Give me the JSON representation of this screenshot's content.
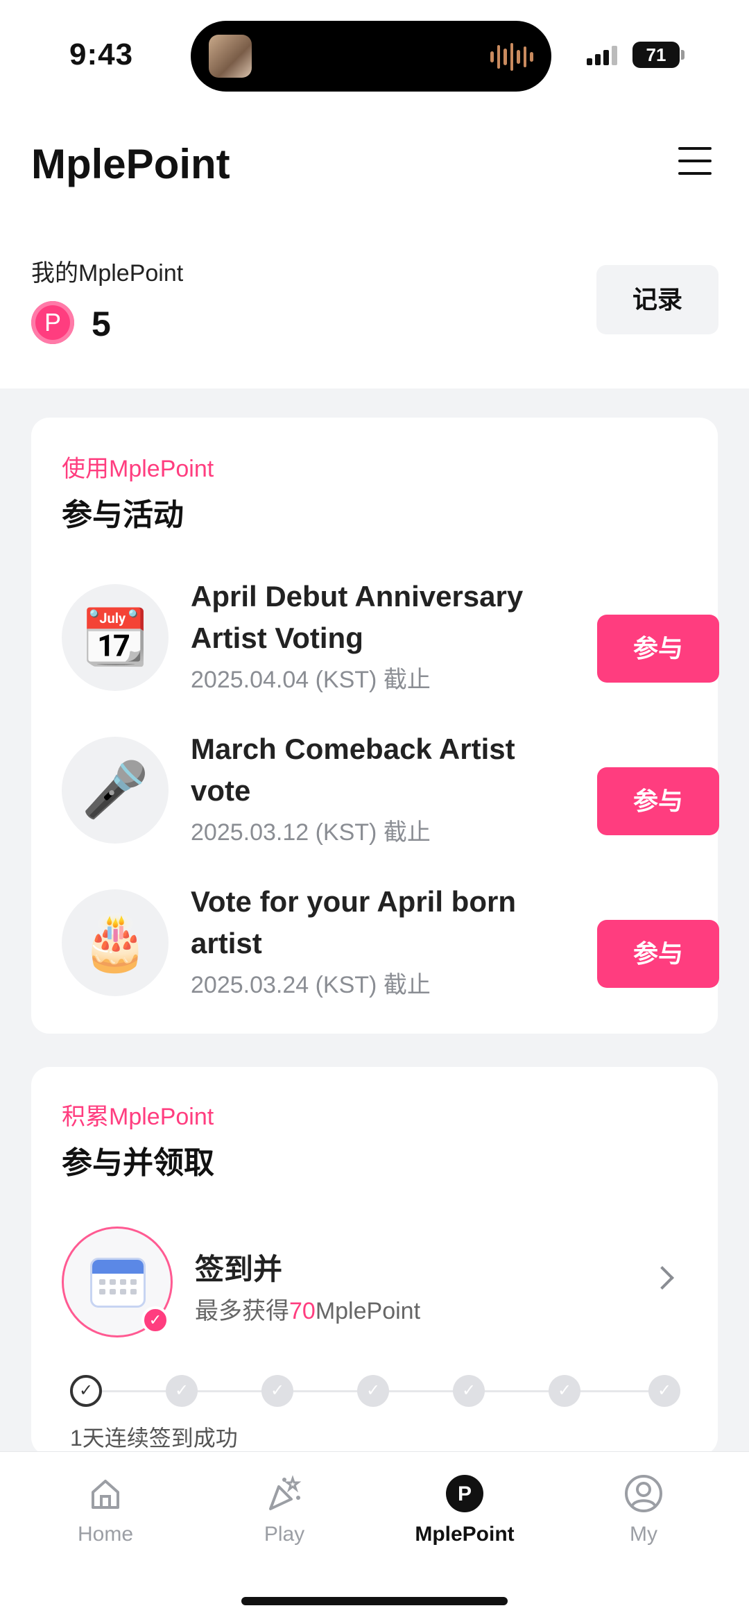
{
  "status_bar": {
    "time": "9:43",
    "battery": "71"
  },
  "header": {
    "title": "MplePoint",
    "menu_icon": "hamburger-menu-icon"
  },
  "points": {
    "label": "我的MplePoint",
    "badge": "P",
    "value": "5",
    "record_button": "记录"
  },
  "events_card": {
    "kicker": "使用MplePoint",
    "title": "参与活动",
    "events": [
      {
        "name": "April Debut Anniversary Artist Voting",
        "deadline": "2025.04.04 (KST) 截止",
        "icon": "calendar-heart-icon",
        "button": "参与"
      },
      {
        "name": "March Comeback Artist vote",
        "deadline": "2025.03.12 (KST) 截止",
        "icon": "microphone-icon",
        "button": "参与"
      },
      {
        "name": "Vote for your April born artist",
        "deadline": "2025.03.24 (KST) 截止",
        "icon": "birthday-cake-icon",
        "button": "参与"
      }
    ]
  },
  "earn_card": {
    "kicker": "积累MplePoint",
    "title": "参与并领取",
    "checkin_title": "签到并",
    "checkin_sub_prefix": "最多获得",
    "checkin_sub_amount": "70",
    "checkin_sub_suffix": "MplePoint",
    "streak_text": "1天连续签到成功"
  },
  "bottom_nav": [
    {
      "label": "Home",
      "icon": "home-icon",
      "active": false
    },
    {
      "label": "Play",
      "icon": "party-popper-icon",
      "active": false
    },
    {
      "label": "MplePoint",
      "icon": "point-p-icon",
      "active": true
    },
    {
      "label": "My",
      "icon": "profile-icon",
      "active": false
    }
  ],
  "colors": {
    "accent": "#ff3d7f",
    "background": "#f2f3f5",
    "text": "#111111"
  }
}
